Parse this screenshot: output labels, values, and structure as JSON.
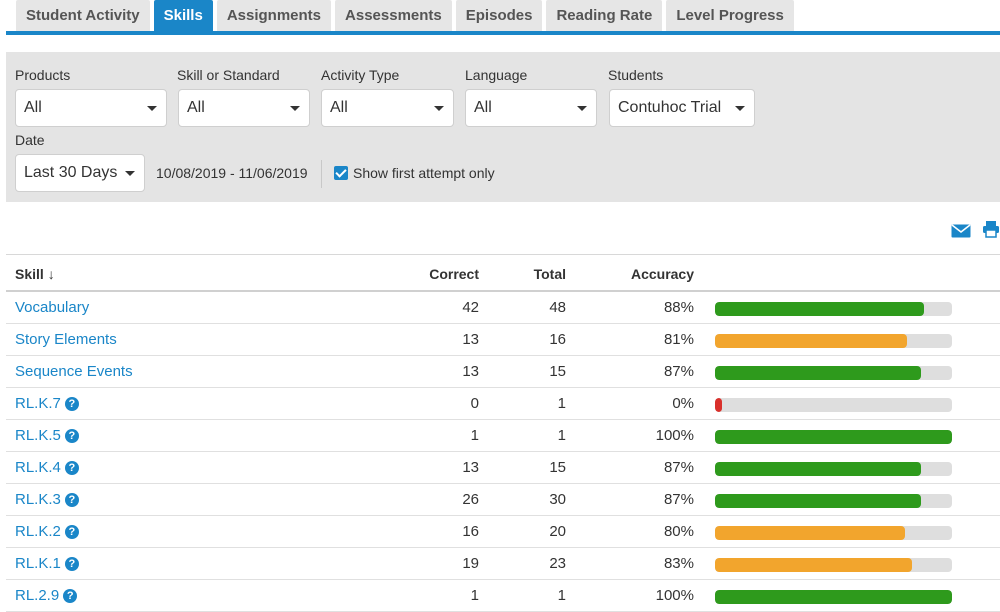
{
  "tabs": [
    {
      "label": "Student Activity",
      "active": false
    },
    {
      "label": "Skills",
      "active": true
    },
    {
      "label": "Assignments",
      "active": false
    },
    {
      "label": "Assessments",
      "active": false
    },
    {
      "label": "Episodes",
      "active": false
    },
    {
      "label": "Reading Rate",
      "active": false
    },
    {
      "label": "Level Progress",
      "active": false
    }
  ],
  "filters": {
    "products": {
      "label": "Products",
      "value": "All"
    },
    "skill": {
      "label": "Skill or Standard",
      "value": "All"
    },
    "activity": {
      "label": "Activity Type",
      "value": "All"
    },
    "language": {
      "label": "Language",
      "value": "All"
    },
    "students": {
      "label": "Students",
      "value": "Contuhoc Trial"
    },
    "date": {
      "label": "Date",
      "value": "Last 30 Days",
      "range": "10/08/2019 - 11/06/2019"
    },
    "first_attempt": {
      "label": "Show first attempt only",
      "checked": true
    }
  },
  "icons": {
    "email": "envelope-icon",
    "print": "printer-icon"
  },
  "table": {
    "headers": {
      "skill": "Skill",
      "sort_glyph": "↓",
      "correct": "Correct",
      "total": "Total",
      "accuracy": "Accuracy"
    },
    "rows": [
      {
        "skill": "Vocabulary",
        "help": false,
        "correct": "42",
        "total": "48",
        "accuracy": "88%",
        "pct": 88,
        "color": "#2e9a1c"
      },
      {
        "skill": "Story Elements",
        "help": false,
        "correct": "13",
        "total": "16",
        "accuracy": "81%",
        "pct": 81,
        "color": "#f2a52d"
      },
      {
        "skill": "Sequence Events",
        "help": false,
        "correct": "13",
        "total": "15",
        "accuracy": "87%",
        "pct": 87,
        "color": "#2e9a1c"
      },
      {
        "skill": "RL.K.7",
        "help": true,
        "correct": "0",
        "total": "1",
        "accuracy": "0%",
        "pct": 3,
        "color": "#d9302b"
      },
      {
        "skill": "RL.K.5",
        "help": true,
        "correct": "1",
        "total": "1",
        "accuracy": "100%",
        "pct": 100,
        "color": "#2e9a1c"
      },
      {
        "skill": "RL.K.4",
        "help": true,
        "correct": "13",
        "total": "15",
        "accuracy": "87%",
        "pct": 87,
        "color": "#2e9a1c"
      },
      {
        "skill": "RL.K.3",
        "help": true,
        "correct": "26",
        "total": "30",
        "accuracy": "87%",
        "pct": 87,
        "color": "#2e9a1c"
      },
      {
        "skill": "RL.K.2",
        "help": true,
        "correct": "16",
        "total": "20",
        "accuracy": "80%",
        "pct": 80,
        "color": "#f2a52d"
      },
      {
        "skill": "RL.K.1",
        "help": true,
        "correct": "19",
        "total": "23",
        "accuracy": "83%",
        "pct": 83,
        "color": "#f2a52d"
      },
      {
        "skill": "RL.2.9",
        "help": true,
        "correct": "1",
        "total": "1",
        "accuracy": "100%",
        "pct": 100,
        "color": "#2e9a1c"
      }
    ]
  }
}
